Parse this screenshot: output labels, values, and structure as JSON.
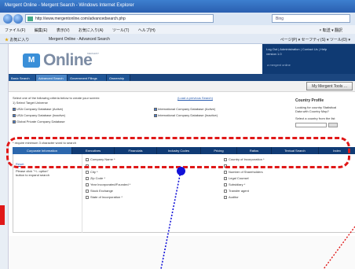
{
  "browser": {
    "title": "Mergent Online - Mergent Search - Windows Internet Explorer",
    "address": "http://www.mergentonline.com/advancedsearch.php",
    "search_placeholder": "Bing",
    "menu": [
      "ファイル(F)",
      "編集(E)",
      "表示(V)",
      "お気に入り(A)",
      "ツール(T)",
      "ヘルプ(H)"
    ],
    "menu_right": "× 転送 ▾ 翻訳",
    "favorites_label": "お気に入り",
    "tab_title": "Mergent Online - Advanced Search",
    "command_bar": "ページ(P) ▾ セーフティ(S) ▾ ツール(O) ▾"
  },
  "header": {
    "logo_icon": "M",
    "logo_text": "Online",
    "logo_sup": "MERGENT",
    "right_links": "Log Out | Administration | Contact Us | Help",
    "right_version": "version 1.0",
    "right_sub": "a mergent online"
  },
  "nav": {
    "tabs": [
      "Basic Search",
      "Advanced Search",
      "Government Filings",
      "Ownership"
    ]
  },
  "toolbar": {
    "my_tools": "My Mergent Tools ..."
  },
  "form": {
    "instruction_1": "Select one of the following criteria below to create your screen:",
    "instruction_2": "1) Select Target Universe",
    "load_link": "(Load a previous Search)",
    "options": [
      "USA Company Database (Active)",
      "USA Company Database (Inactive)",
      "Global Private Company Database",
      "International Company Database (Active)",
      "International Company Database (Inactive)"
    ],
    "require_text": "* require minimum 3 character word to search"
  },
  "profile": {
    "title": "Country Profile",
    "line1": "Looking for country Statistical",
    "line2": "Data with Country Map?",
    "line3": "Select a country from the list"
  },
  "section_tabs": [
    "Corporate Information",
    "Executives",
    "Financials",
    "Industry Codes",
    "Pricing",
    "Ratios",
    "Textual Search",
    "Index"
  ],
  "panel": {
    "reset": "Reset",
    "note_1": "Please click \"+/- option\"",
    "note_2": "button to expand search",
    "fields_left": [
      "Company Name *",
      "",
      "City *",
      "Zip Code *",
      "Year Incorporated/Founded *",
      "Stock Exchange",
      "State of Incorporation *"
    ],
    "fields_right": [
      "Country of Incorporation *",
      "",
      "Number of Shareholders",
      "Legal Counsel",
      "Subsidiary *",
      "Transfer agent",
      "Auditor"
    ]
  },
  "colors": {
    "annotation": "#e01818",
    "pointer": "#1212d8",
    "nav": "#1b467f"
  }
}
